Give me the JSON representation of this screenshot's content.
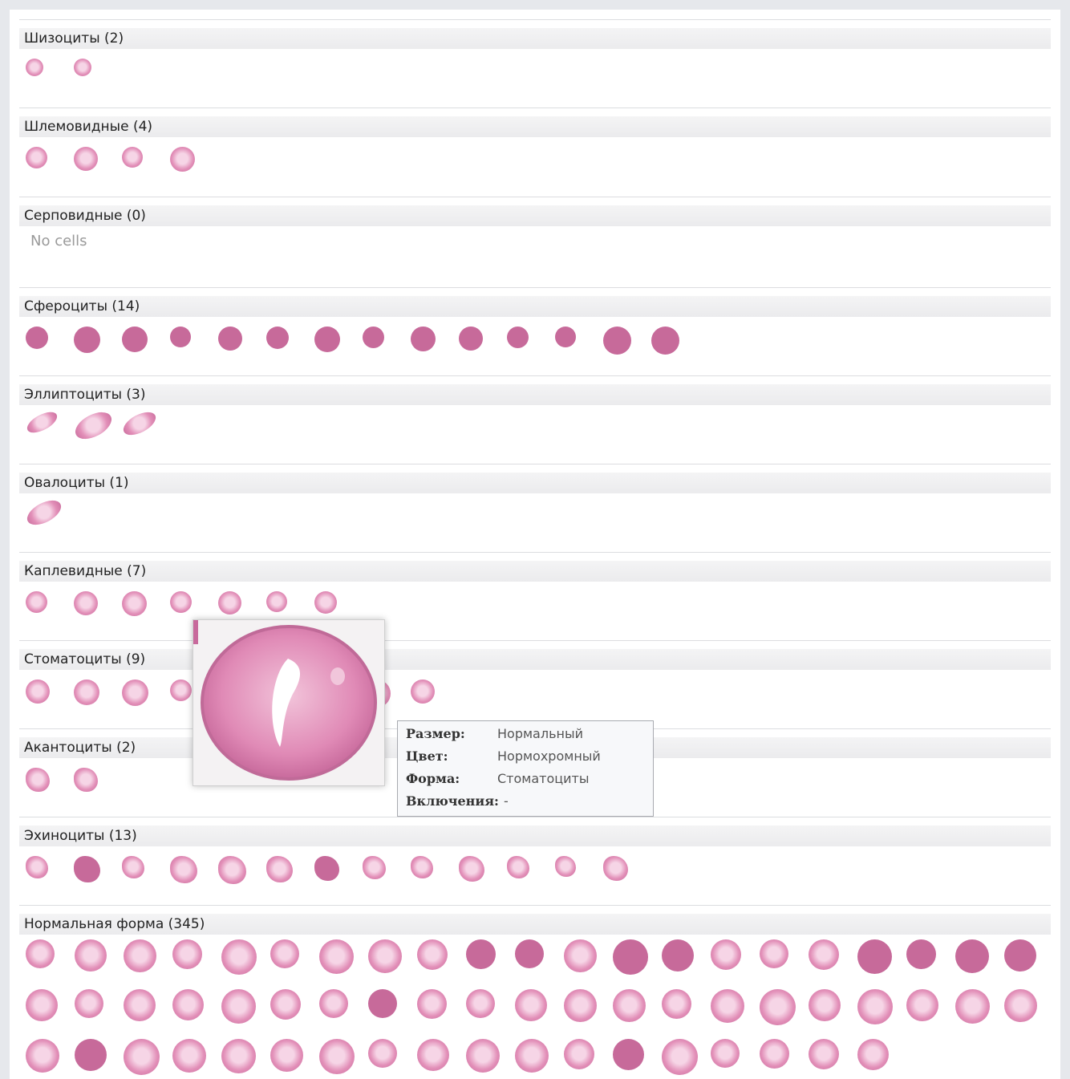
{
  "sections": [
    {
      "key": "schizo",
      "label": "Шизоциты (2)",
      "count": 2
    },
    {
      "key": "helmet",
      "label": "Шлемовидные (4)",
      "count": 4
    },
    {
      "key": "sickle",
      "label": "Серповидные (0)",
      "count": 0,
      "empty_text": "No cells"
    },
    {
      "key": "sphero",
      "label": "Сфероциты (14)",
      "count": 14
    },
    {
      "key": "ellipto",
      "label": "Эллиптоциты (3)",
      "count": 3
    },
    {
      "key": "ovalo",
      "label": "Овалоциты (1)",
      "count": 1
    },
    {
      "key": "tear",
      "label": "Каплевидные (7)",
      "count": 7
    },
    {
      "key": "stomato",
      "label": "Стоматоциты (9)",
      "count": 9
    },
    {
      "key": "acantho",
      "label": "Акантоциты (2)",
      "count": 2
    },
    {
      "key": "echino",
      "label": "Эхиноциты (13)",
      "count": 13
    },
    {
      "key": "normal",
      "label": "Нормальная форма (345)",
      "count": 345
    }
  ],
  "tooltip": {
    "size_label": "Размер:",
    "size_value": "Нормальный",
    "color_label": "Цвет:",
    "color_value": "Нормохромный",
    "shape_label": "Форма:",
    "shape_value": "Стоматоциты",
    "inclusions_label": "Включения:",
    "inclusions_value": "-"
  },
  "colors": {
    "cell_fill": "#e28fb8",
    "cell_dark": "#c76a9a",
    "cell_light": "#f6d5e6",
    "header_bg": "#ededef",
    "tooltip_border": "#a8aab0"
  }
}
